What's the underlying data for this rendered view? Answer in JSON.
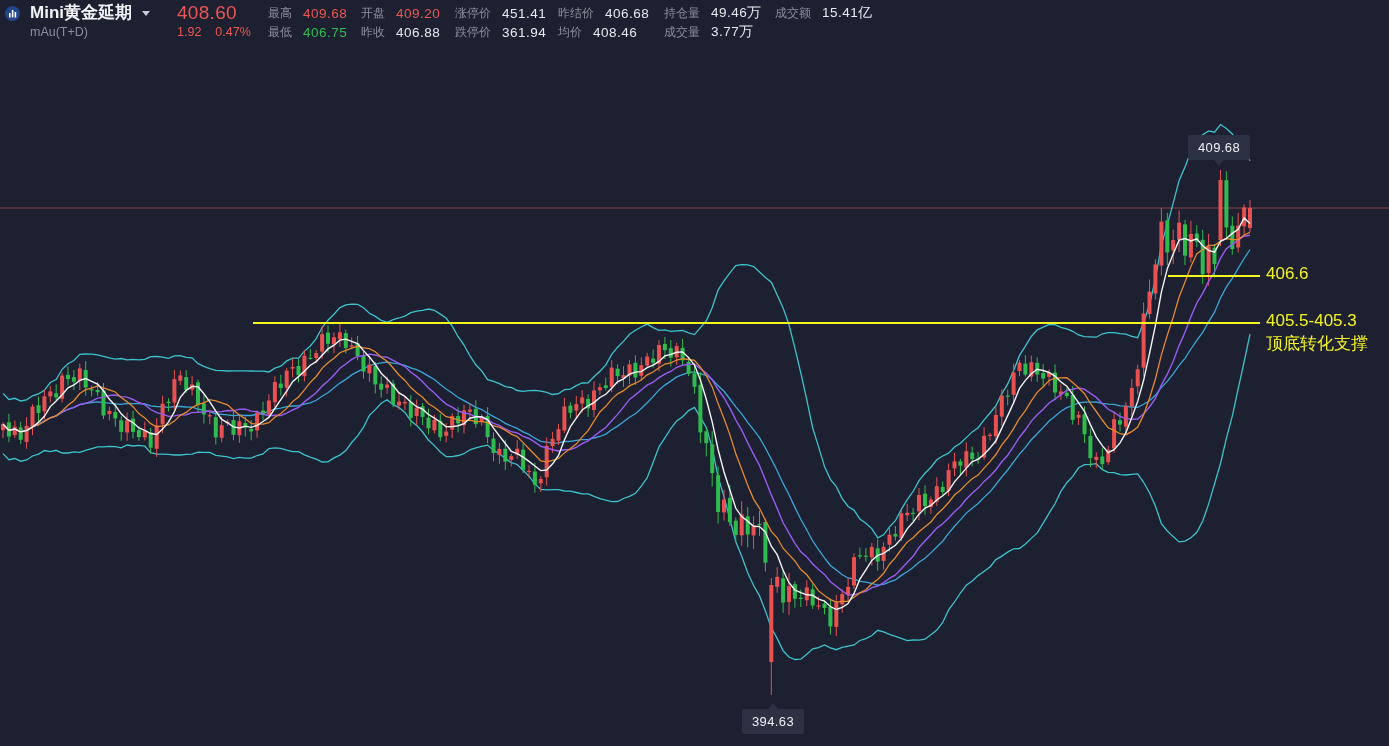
{
  "instrument": {
    "name": "Mini黄金延期",
    "code": "mAu(T+D)"
  },
  "quote": {
    "price": "408.60",
    "change": "1.92",
    "change_percent": "0.47%",
    "color": "#ec5753"
  },
  "stat_rows": [
    {
      "items": [
        {
          "label": "最高",
          "value": "409.68",
          "color": "#ec5753"
        },
        {
          "label": "开盘",
          "value": "409.20",
          "color": "#ec5753"
        },
        {
          "label": "涨停价",
          "value": "451.41",
          "color": "#e6e8ef"
        },
        {
          "label": "昨结价",
          "value": "406.68",
          "color": "#e6e8ef"
        },
        {
          "label": "持仓量",
          "value": "49.46万",
          "color": "#e6e8ef"
        },
        {
          "label": "成交额",
          "value": "15.41亿",
          "color": "#e6e8ef"
        }
      ]
    },
    {
      "items": [
        {
          "label": "最低",
          "value": "406.75",
          "color": "#2fbd52"
        },
        {
          "label": "昨收",
          "value": "406.88",
          "color": "#e6e8ef"
        },
        {
          "label": "跌停价",
          "value": "361.94",
          "color": "#e6e8ef"
        },
        {
          "label": "均价",
          "value": "408.46",
          "color": "#e6e8ef"
        },
        {
          "label": "成交量",
          "value": "3.77万",
          "color": "#e6e8ef"
        }
      ]
    }
  ],
  "chart": {
    "high_tag": "409.68",
    "low_tag": "394.63",
    "annotations": [
      {
        "label": "406.6"
      },
      {
        "label": "405.5-405.3",
        "note": "顶底转化支撑"
      }
    ]
  }
}
